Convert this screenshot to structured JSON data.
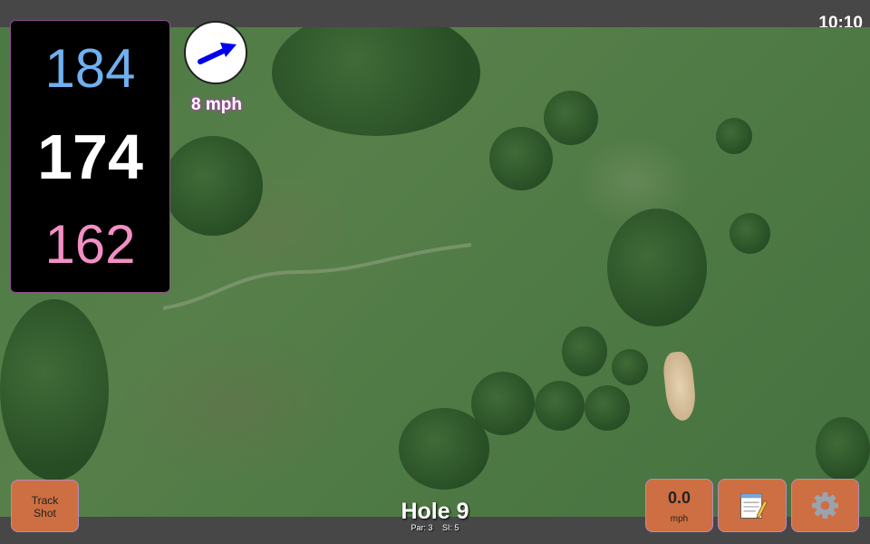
{
  "status": {
    "time": "10:10"
  },
  "distances": {
    "back": "184",
    "middle": "174",
    "front": "162"
  },
  "wind": {
    "speed_text": "8 mph",
    "direction_icon": "wind-arrow-icon",
    "arrow_color": "#0000ee"
  },
  "buttons": {
    "track_shot_line1": "Track",
    "track_shot_line2": "Shot",
    "speed_value": "0.0",
    "speed_unit": "mph",
    "notes_icon": "notepad-icon",
    "settings_icon": "gear-icon"
  },
  "hole": {
    "title": "Hole 9",
    "par": "Par: 3",
    "si": "SI: 5"
  },
  "colors": {
    "back_distance": "#6fb0f0",
    "middle_distance": "#ffffff",
    "front_distance": "#f28fc4",
    "button_bg": "#cd6f42"
  }
}
